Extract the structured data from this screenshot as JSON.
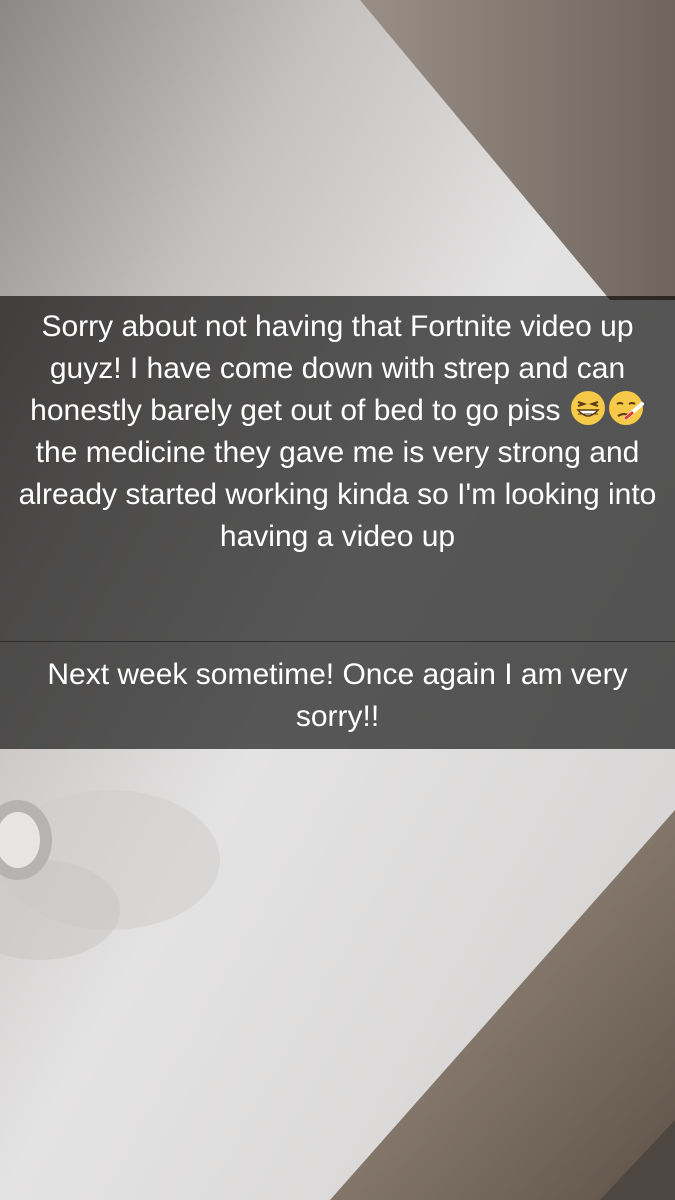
{
  "snap": {
    "caption_1": {
      "before_emoji": "Sorry about not having that Fortnite video up guyz! I have come down with strep and can honestly barely get out of bed to go piss ",
      "emoji_1": "grinning-squinting-face-icon",
      "emoji_2": "face-with-thermometer-icon",
      "after_emoji": " the medicine they gave me is very strong and already started working kinda so I'm looking into having a video up"
    },
    "caption_2": {
      "text": "Next week sometime! Once again I am very sorry!!"
    }
  },
  "colors": {
    "caption_background": "#000000",
    "caption_text": "#ffffff",
    "ceiling": "#dedddc",
    "wall": "#8a7f77",
    "emoji_yellow": "#f7c948"
  }
}
